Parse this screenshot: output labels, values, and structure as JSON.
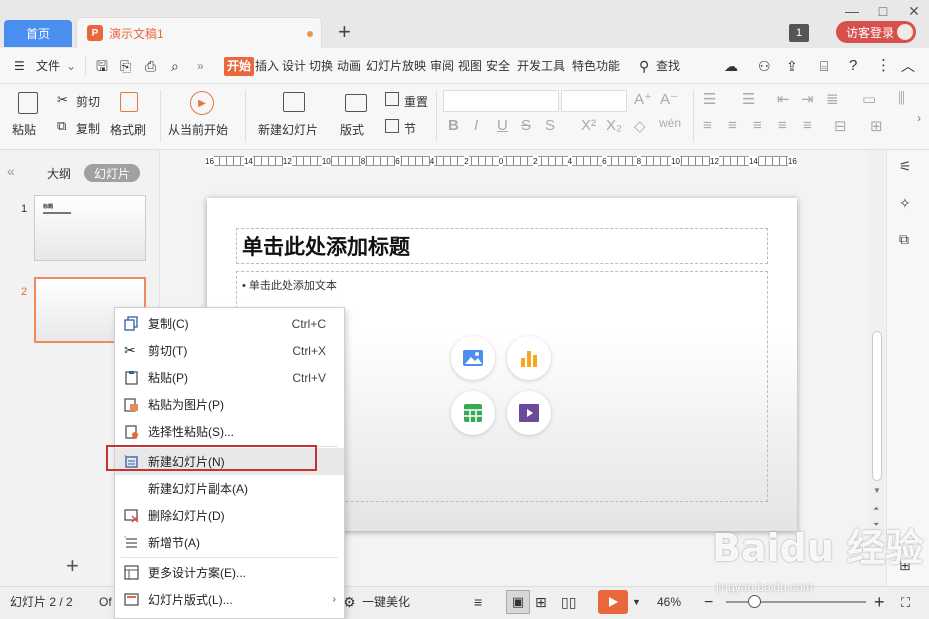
{
  "tabs": {
    "home": "首页",
    "doc": "演示文稿1",
    "doc_icon": "P",
    "new_tab": "+"
  },
  "window": {
    "badge": "1",
    "login": "访客登录"
  },
  "menu": {
    "file": "文件",
    "items": [
      "开始",
      "插入",
      "设计",
      "切换",
      "动画",
      "幻灯片放映",
      "审阅",
      "视图",
      "安全",
      "开发工具",
      "特色功能"
    ],
    "search": "查找"
  },
  "toolbar": {
    "paste": "粘贴",
    "cut": "剪切",
    "copy": "复制",
    "format_painter": "格式刷",
    "from_start": "从当前开始",
    "new_slide": "新建幻灯片",
    "layout": "版式",
    "reset": "重置",
    "section": "节"
  },
  "left_panel": {
    "outline": "大纲",
    "slides": "幻灯片",
    "slide_numbers": [
      "1",
      "2"
    ],
    "thumb1_title": "标题",
    "add": "+"
  },
  "ruler": {
    "labels": [
      "16",
      "14",
      "12",
      "10",
      "8",
      "6",
      "4",
      "2",
      "0",
      "2",
      "4",
      "6",
      "8",
      "10",
      "12",
      "14",
      "16"
    ]
  },
  "slide": {
    "title_placeholder": "单击此处添加标题",
    "text_placeholder": "单击此处添加文本"
  },
  "context_menu": {
    "items": [
      {
        "icon": "copy-icon",
        "label": "复制(C)",
        "shortcut": "Ctrl+C"
      },
      {
        "icon": "scissors-icon",
        "label": "剪切(T)",
        "shortcut": "Ctrl+X"
      },
      {
        "icon": "paste-icon",
        "label": "粘贴(P)",
        "shortcut": "Ctrl+V"
      },
      {
        "icon": "paste-as-image-icon",
        "label": "粘贴为图片(P)",
        "shortcut": ""
      },
      {
        "icon": "paste-special-icon",
        "label": "选择性粘贴(S)...",
        "shortcut": ""
      },
      {
        "icon": "new-slide-icon",
        "label": "新建幻灯片(N)",
        "shortcut": ""
      },
      {
        "icon": "",
        "label": "新建幻灯片副本(A)",
        "shortcut": ""
      },
      {
        "icon": "delete-slide-icon",
        "label": "删除幻灯片(D)",
        "shortcut": ""
      },
      {
        "icon": "new-section-icon",
        "label": "新增节(A)",
        "shortcut": ""
      },
      {
        "icon": "design-icon",
        "label": "更多设计方案(E)...",
        "shortcut": ""
      },
      {
        "icon": "slide-layout-icon",
        "label": "幻灯片版式(L)...",
        "shortcut": ""
      }
    ],
    "highlighted": "新建幻灯片(N)"
  },
  "status": {
    "slide_count": "幻灯片 2 / 2",
    "office_theme": "Of",
    "beautify": "一键美化",
    "zoom": "46%"
  },
  "watermark": {
    "brand": "Baidu 经验",
    "url": "jingyan.baidu.com"
  },
  "colors": {
    "accent": "#e9683b",
    "home_tab": "#4a8ef0",
    "login": "#d6514e",
    "highlight_box": "#c43232"
  }
}
